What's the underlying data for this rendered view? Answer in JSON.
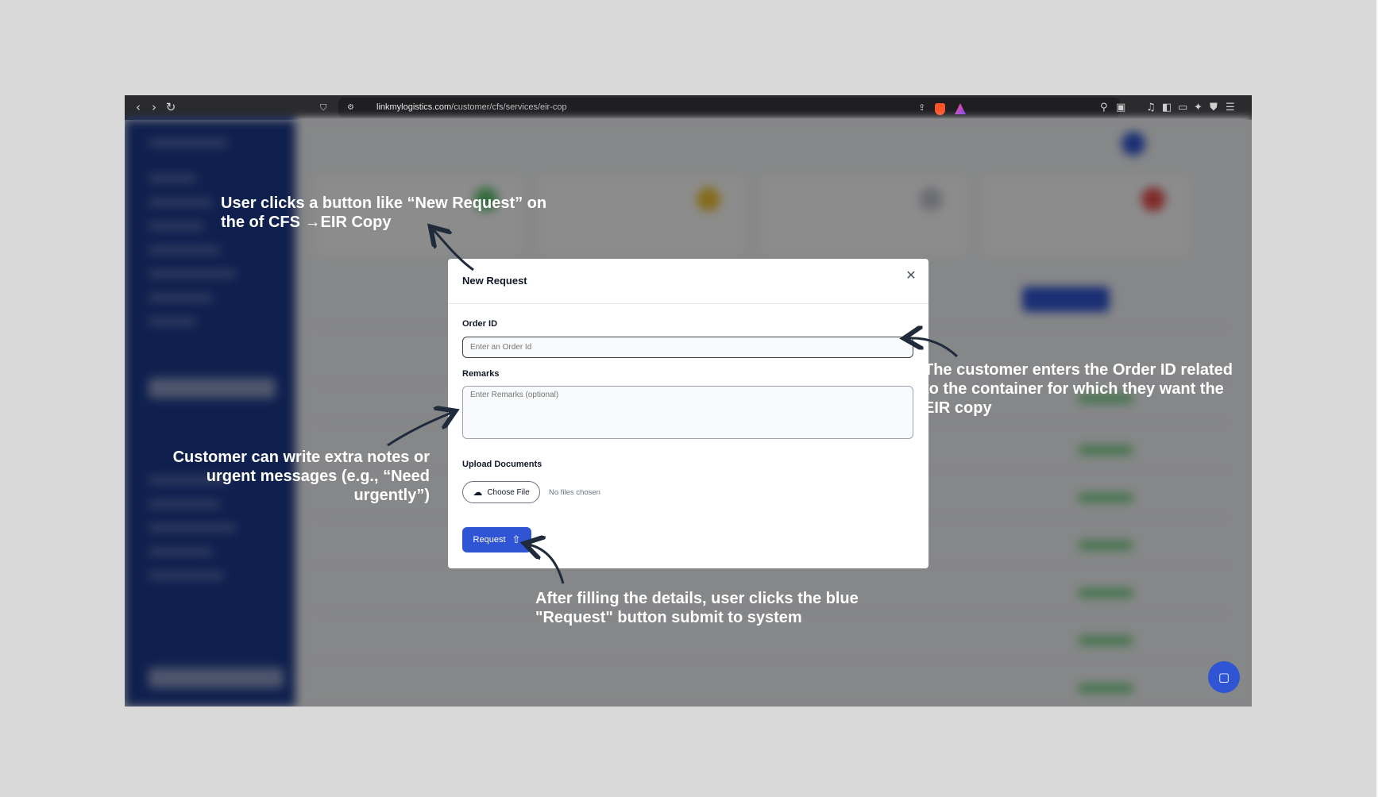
{
  "browser": {
    "url_host": "linkmylogistics.com",
    "url_path": "/customer/cfs/services/eir-cop"
  },
  "modal": {
    "title": "New Request",
    "order_id_label": "Order ID",
    "order_id_placeholder": "Enter an Order Id",
    "remarks_label": "Remarks",
    "remarks_placeholder": "Enter Remarks (optional)",
    "upload_label": "Upload Documents",
    "choose_file_label": "Choose File",
    "no_files_text": "No files chosen",
    "request_label": "Request"
  },
  "annotations": {
    "new_request": "User clicks a button like “New Request” on the of CFS →EIR Copy",
    "order_id": "The customer enters the Order ID related to the container for which they want the EIR copy",
    "remarks": "Customer can write extra notes or urgent messages (e.g., “Need urgently”)",
    "request": "After filling the details, user clicks the blue \"Request\" button submit to system"
  },
  "icons": {
    "back": "chevron-left-icon",
    "forward": "chevron-right-icon",
    "reload": "reload-icon",
    "bookmark": "bookmark-icon",
    "close": "close-icon",
    "upload_cloud": "cloud-upload-icon",
    "upload": "upload-icon",
    "chat": "chat-icon"
  },
  "colors": {
    "accent": "#2f55d4",
    "sidebar": "#1d3a8f",
    "annotation_text": "#ffffff",
    "arrow": "#1f2a3a"
  }
}
